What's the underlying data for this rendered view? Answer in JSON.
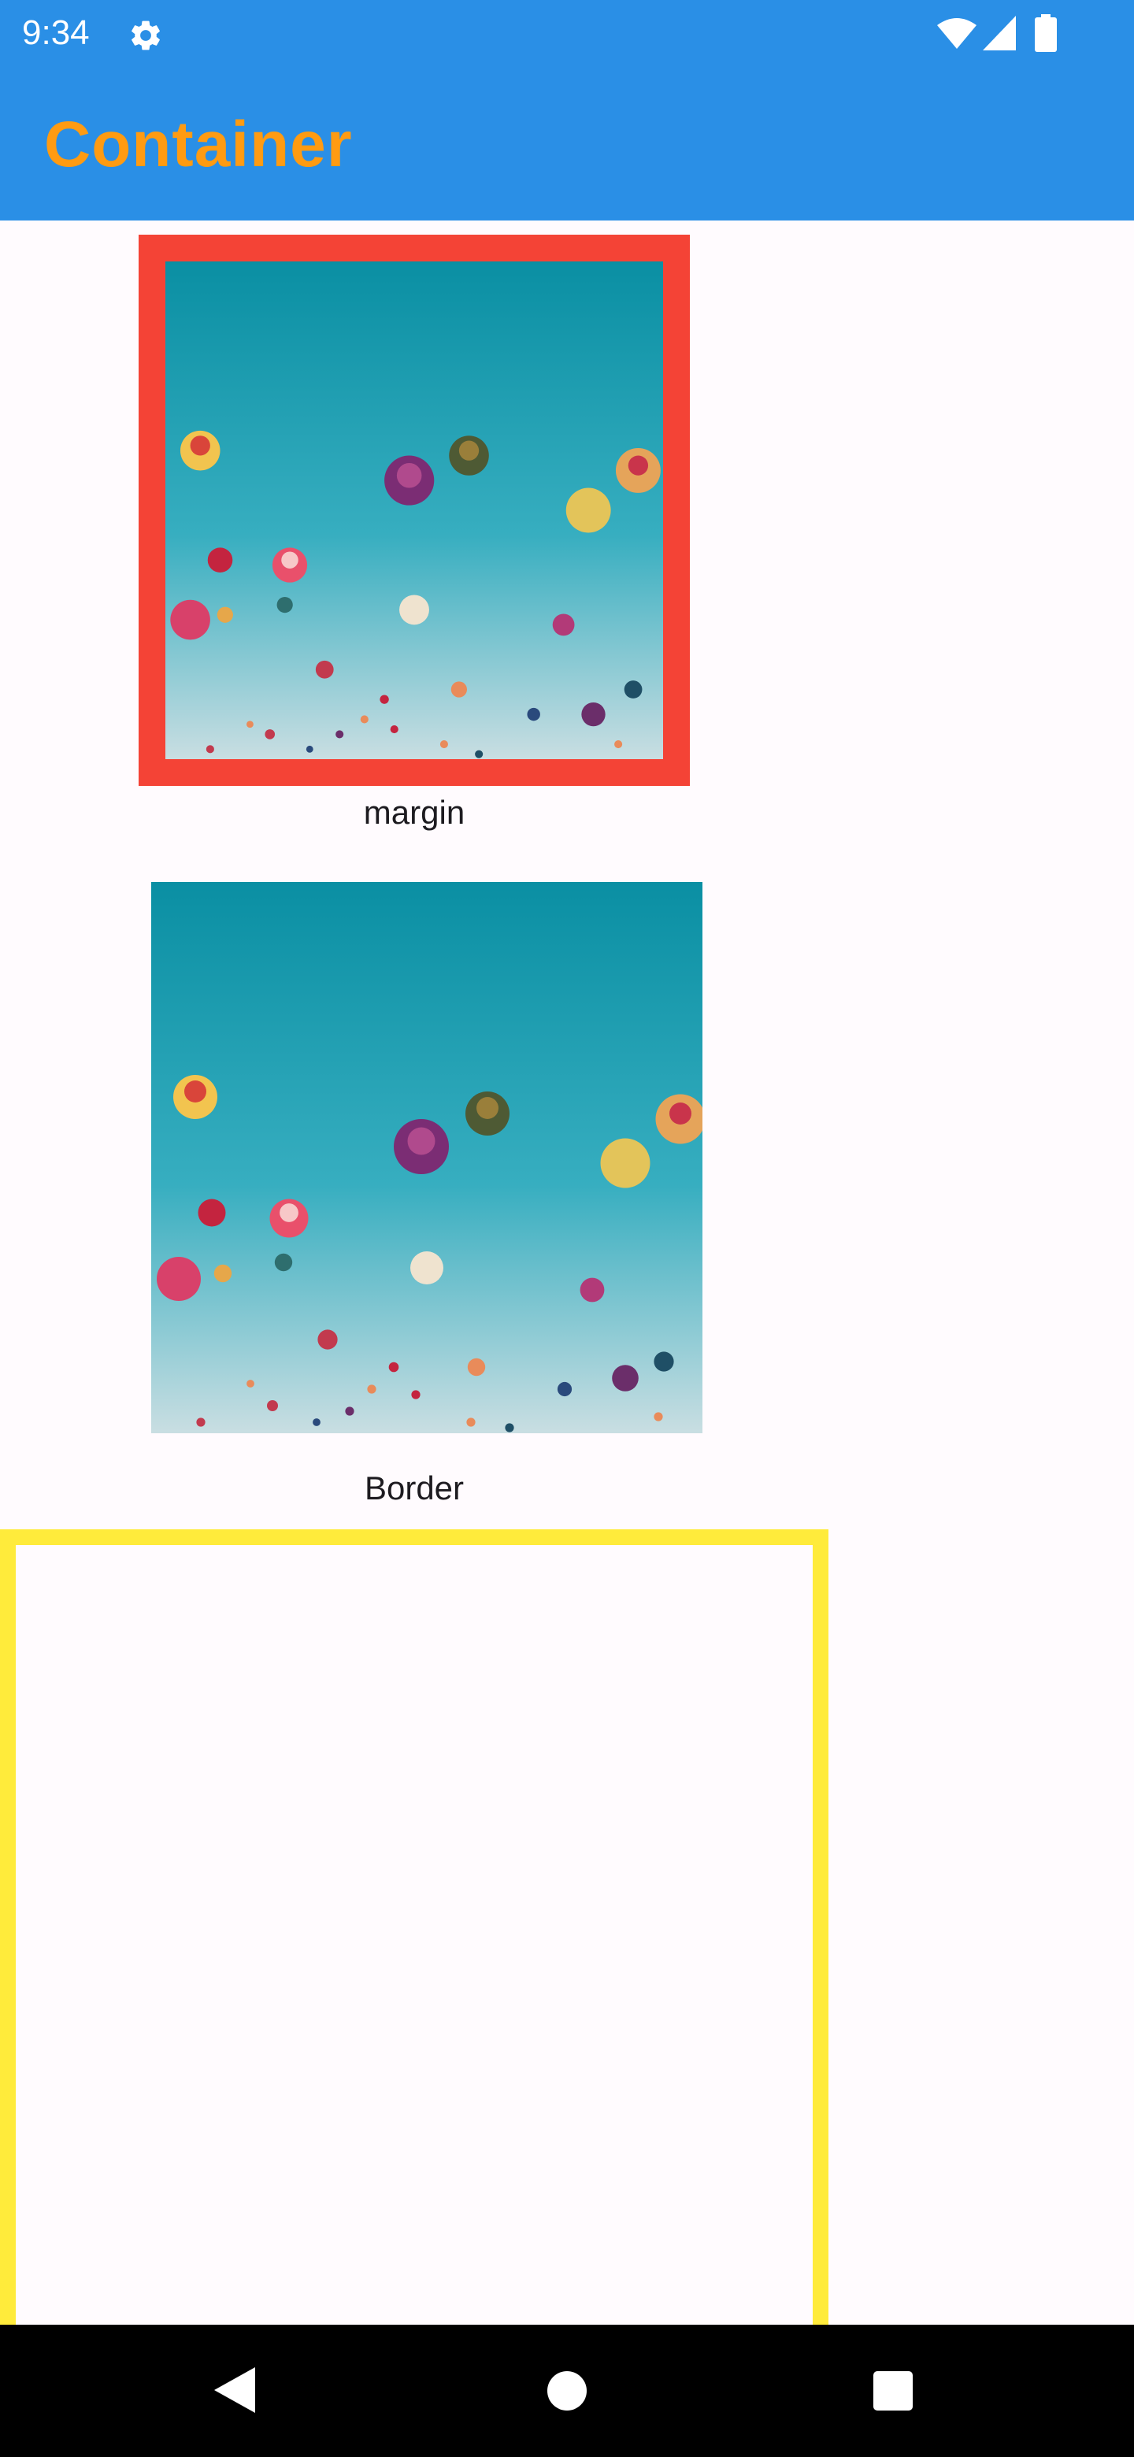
{
  "status_bar": {
    "time": "9:34",
    "icons": [
      "gear-icon",
      "wifi-icon",
      "signal-icon",
      "battery-icon"
    ]
  },
  "app_bar": {
    "title": "Container",
    "background_color": "#2a8fe6",
    "title_color": "#ff9b12"
  },
  "containers": {
    "margin_caption": "margin",
    "margin_frame_color": "#f44336",
    "border_caption": "Border",
    "yellow_border_color": "#ffeb3b",
    "photo_subject": "hot-air balloons in a teal sky"
  },
  "nav_bar": {
    "buttons": [
      "back-button",
      "home-button",
      "recents-button"
    ]
  }
}
